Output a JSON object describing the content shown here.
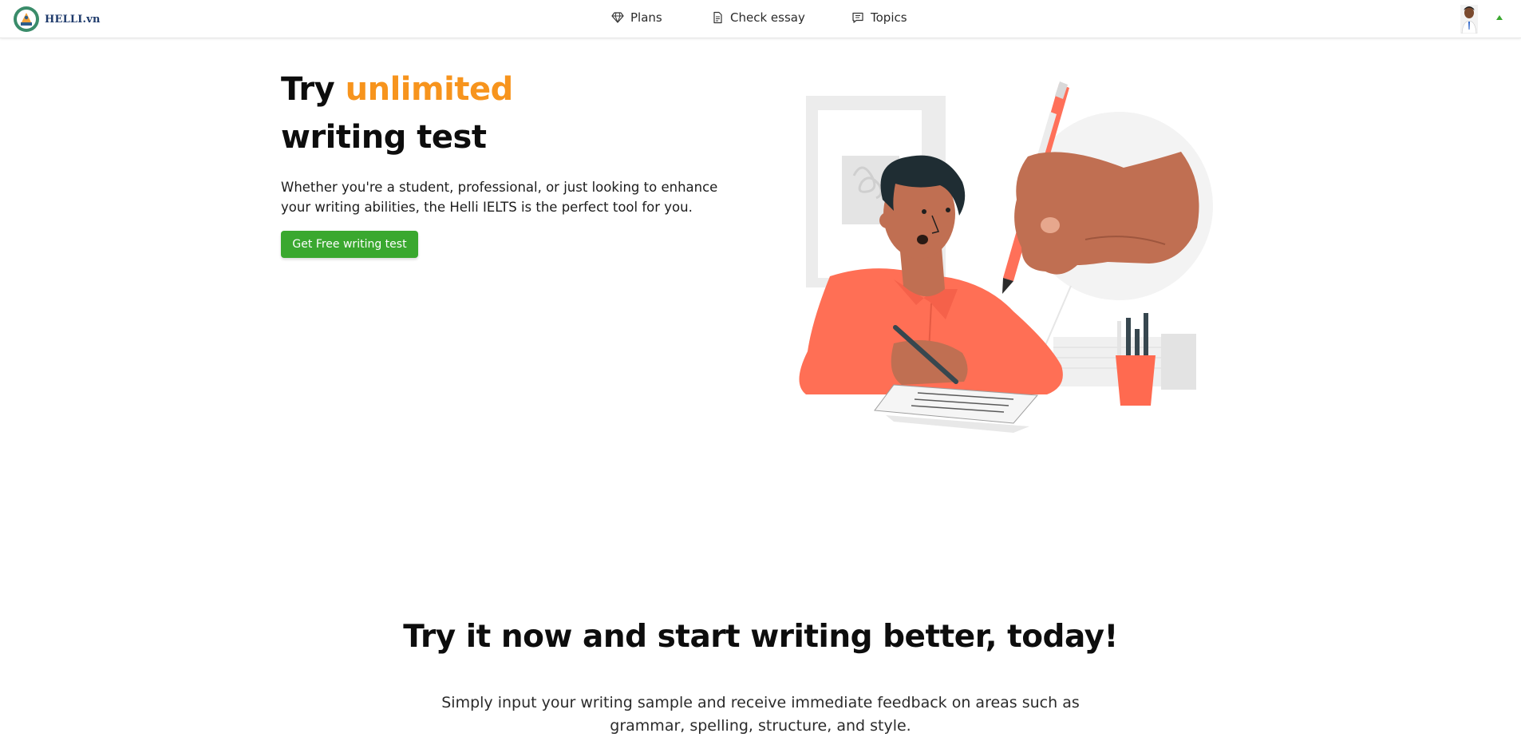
{
  "header": {
    "brand": "HELLI.vn",
    "nav": [
      {
        "label": "Plans",
        "icon": "diamond-icon"
      },
      {
        "label": "Check essay",
        "icon": "document-icon"
      },
      {
        "label": "Topics",
        "icon": "message-square-icon"
      }
    ],
    "avatar_icon": "user-avatar",
    "caret_icon": "caret-up-icon"
  },
  "hero": {
    "title_prefix": "Try ",
    "title_accent": "unlimited",
    "title_line2": "writing test",
    "description": "Whether you're a student, professional, or just looking to enhance your writing abilities, the Helli IELTS is the perfect tool for you.",
    "cta_label": "Get Free writing test"
  },
  "section": {
    "title": "Try it now and start writing better, today!",
    "description": "Simply input your writing sample and receive immediate feedback on areas such as grammar, spelling, structure, and style."
  },
  "colors": {
    "accent": "#f7941d",
    "primary_button": "#3aa82f",
    "brand_text": "#1e3a6b"
  }
}
